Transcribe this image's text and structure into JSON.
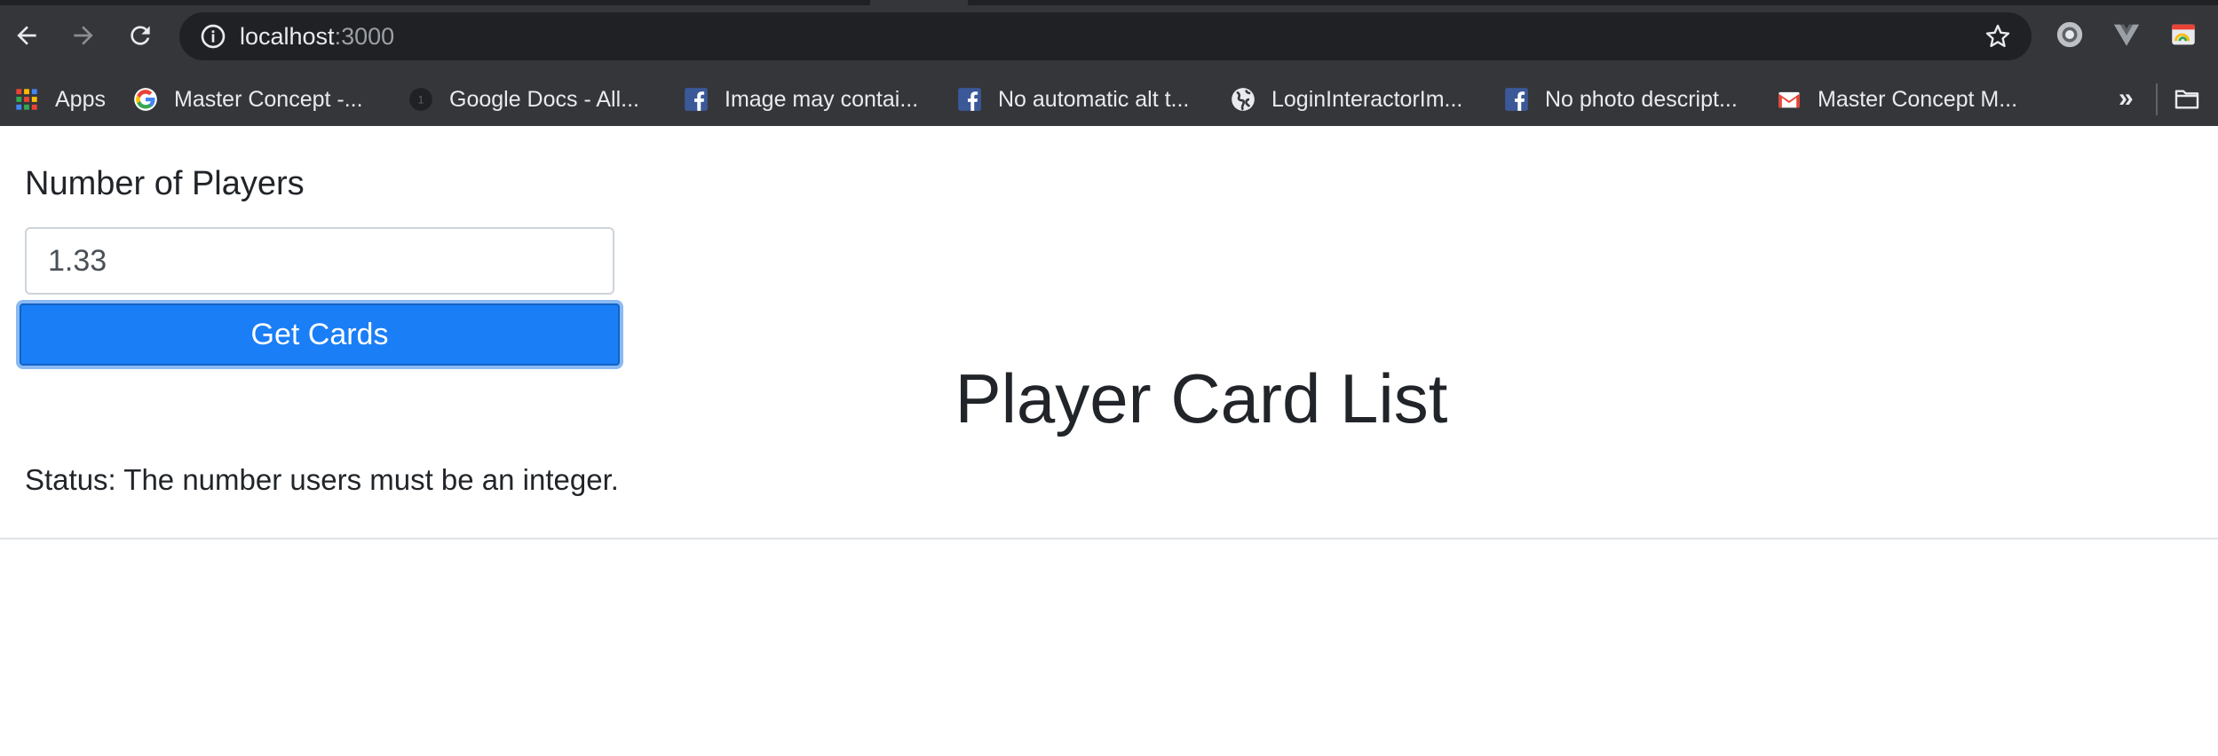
{
  "browser": {
    "url_host": "localhost",
    "url_port": ":3000",
    "bookmarks": [
      {
        "label": "Apps",
        "icon": "apps-grid-icon"
      },
      {
        "label": "Master Concept -...",
        "icon": "google-icon"
      },
      {
        "label": "Google Docs - All...",
        "icon": "docs-dark-icon"
      },
      {
        "label": "Image may contai...",
        "icon": "facebook-icon"
      },
      {
        "label": "No automatic alt t...",
        "icon": "facebook-icon"
      },
      {
        "label": "LoginInteractorIm...",
        "icon": "globe-icon"
      },
      {
        "label": "No photo descript...",
        "icon": "facebook-icon"
      },
      {
        "label": "Master Concept M...",
        "icon": "gmail-icon"
      }
    ],
    "more_label": "»"
  },
  "form": {
    "players_label": "Number of Players",
    "players_value": "1.33",
    "get_cards_label": "Get Cards"
  },
  "main": {
    "title": "Player Card List",
    "status_text": "Status: The number users must be an integer."
  },
  "colors": {
    "chrome_bg": "#35363a",
    "omnibox_bg": "#202124",
    "primary_button": "#1a7ef6",
    "text": "#212529"
  }
}
